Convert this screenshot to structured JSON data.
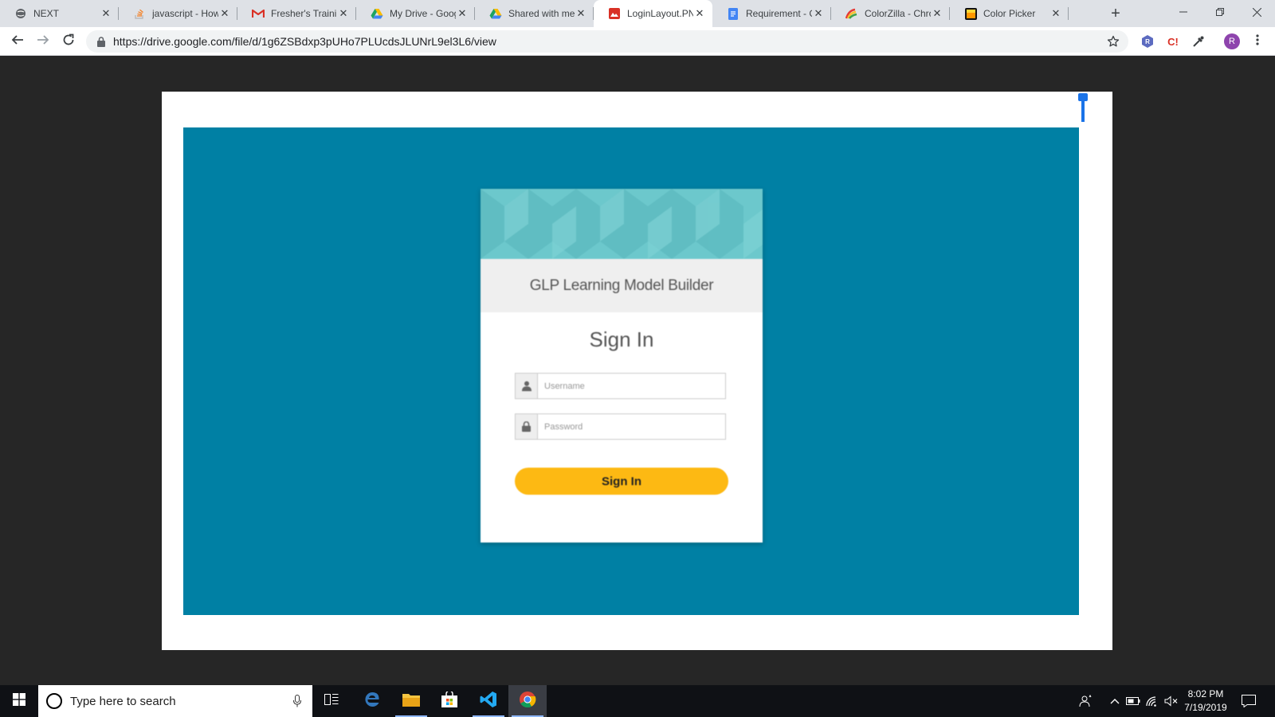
{
  "browser": {
    "tabs": [
      {
        "title": "NEXT",
        "icon": "globe-icon"
      },
      {
        "title": "javascript - How",
        "icon": "stackoverflow-icon"
      },
      {
        "title": "Fresher's Training",
        "icon": "gmail-icon"
      },
      {
        "title": "My Drive - Google",
        "icon": "google-drive-icon"
      },
      {
        "title": "Shared with me",
        "icon": "google-drive-icon"
      },
      {
        "title": "LoginLayout.PNG",
        "icon": "image-file-icon",
        "active": true
      },
      {
        "title": "Requirement - G",
        "icon": "google-docs-icon"
      },
      {
        "title": "ColorZilla - Chro",
        "icon": "colorzilla-icon"
      },
      {
        "title": "Color Picker",
        "icon": "color-picker-icon"
      }
    ],
    "new_tab": "+",
    "url": "https://drive.google.com/file/d/1g6ZSBdxp3pUHo7PLUcdsJLUNrL9el3L6/view",
    "profile_initial": "R",
    "extension_badge": "R",
    "extension_label": "C!"
  },
  "login_mockup": {
    "app_title": "GLP Learning Model Builder",
    "heading": "Sign In",
    "username_placeholder": "Username",
    "password_placeholder": "Password",
    "signin_button": "Sign In"
  },
  "taskbar": {
    "search_placeholder": "Type here to search",
    "time": "8:02 PM",
    "date": "7/19/2019"
  },
  "colors": {
    "canvas_bg": "#0080a4",
    "banner": "#6cc8cc",
    "button": "#fdb913",
    "viewer_bg": "#262626"
  }
}
